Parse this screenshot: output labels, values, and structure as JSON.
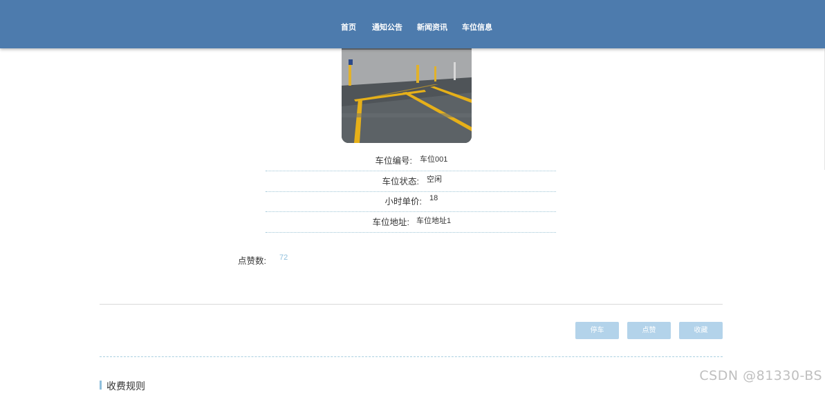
{
  "nav": {
    "items": [
      {
        "label": "首页"
      },
      {
        "label": "通知公告"
      },
      {
        "label": "新闻资讯"
      },
      {
        "label": "车位信息"
      }
    ]
  },
  "detail": {
    "fields": [
      {
        "label": "车位编号:",
        "value": "车位001"
      },
      {
        "label": "车位状态:",
        "value": "空闲"
      },
      {
        "label": "小时单价:",
        "value": "18"
      },
      {
        "label": "车位地址:",
        "value": "车位地址1"
      }
    ],
    "likes_label": "点赞数:",
    "likes_value": "72"
  },
  "actions": {
    "park_label": "停车",
    "like_label": "点赞",
    "favorite_label": "收藏"
  },
  "section": {
    "title": "收费规则"
  },
  "watermark": "CSDN @81330-BS",
  "colors": {
    "navbar": "#4d7bad",
    "button": "#b3d3ea",
    "accent": "#8fbfdc"
  }
}
